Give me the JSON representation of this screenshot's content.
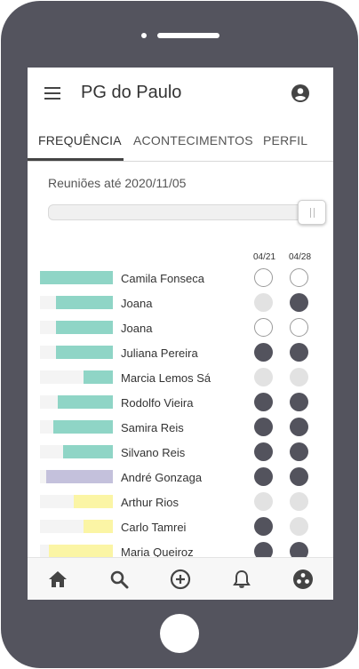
{
  "app": {
    "title": "PG do Paulo"
  },
  "tabs": [
    {
      "label": "FREQUÊNCIA",
      "active": true
    },
    {
      "label": "ACONTECIMENTOS",
      "active": false
    },
    {
      "label": "PERFIL",
      "active": false
    }
  ],
  "filter": {
    "label": "Reuniões até 2020/11/05",
    "slider_value_fraction": 1.0
  },
  "dates": [
    "04/21",
    "04/28"
  ],
  "colors": {
    "teal": "#8fd5c6",
    "lavender": "#c4c1dc",
    "yellow": "#fbf5a5",
    "present": "#53535d",
    "absent": "#e2e2e2",
    "frame": "#54545e"
  },
  "members": [
    {
      "name": "Camila Fonseca",
      "attendance_fraction": 1.0,
      "bar_color": "teal",
      "status": [
        "empty",
        "empty"
      ]
    },
    {
      "name": "Joana",
      "attendance_fraction": 0.78,
      "bar_color": "teal",
      "status": [
        "absent",
        "present"
      ]
    },
    {
      "name": "Joana",
      "attendance_fraction": 0.78,
      "bar_color": "teal",
      "status": [
        "empty",
        "empty"
      ]
    },
    {
      "name": "Juliana Pereira",
      "attendance_fraction": 0.78,
      "bar_color": "teal",
      "status": [
        "present",
        "present"
      ]
    },
    {
      "name": "Marcia Lemos Sá",
      "attendance_fraction": 0.4,
      "bar_color": "teal",
      "status": [
        "absent",
        "absent"
      ]
    },
    {
      "name": "Rodolfo Vieira",
      "attendance_fraction": 0.76,
      "bar_color": "teal",
      "status": [
        "present",
        "present"
      ]
    },
    {
      "name": "Samira Reis",
      "attendance_fraction": 0.82,
      "bar_color": "teal",
      "status": [
        "present",
        "present"
      ]
    },
    {
      "name": "Silvano Reis",
      "attendance_fraction": 0.68,
      "bar_color": "teal",
      "status": [
        "present",
        "present"
      ]
    },
    {
      "name": "André Gonzaga",
      "attendance_fraction": 0.91,
      "bar_color": "lavender",
      "status": [
        "present",
        "present"
      ]
    },
    {
      "name": "Arthur Rios",
      "attendance_fraction": 0.54,
      "bar_color": "yellow",
      "status": [
        "absent",
        "absent"
      ]
    },
    {
      "name": "Carlo Tamrei",
      "attendance_fraction": 0.4,
      "bar_color": "yellow",
      "status": [
        "present",
        "absent"
      ]
    },
    {
      "name": "Maria Queiroz",
      "attendance_fraction": 0.88,
      "bar_color": "yellow",
      "status": [
        "present",
        "present"
      ]
    }
  ],
  "nav": [
    {
      "icon": "home-icon"
    },
    {
      "icon": "search-icon"
    },
    {
      "icon": "add-circle-icon"
    },
    {
      "icon": "bell-icon"
    },
    {
      "icon": "group-icon"
    }
  ]
}
